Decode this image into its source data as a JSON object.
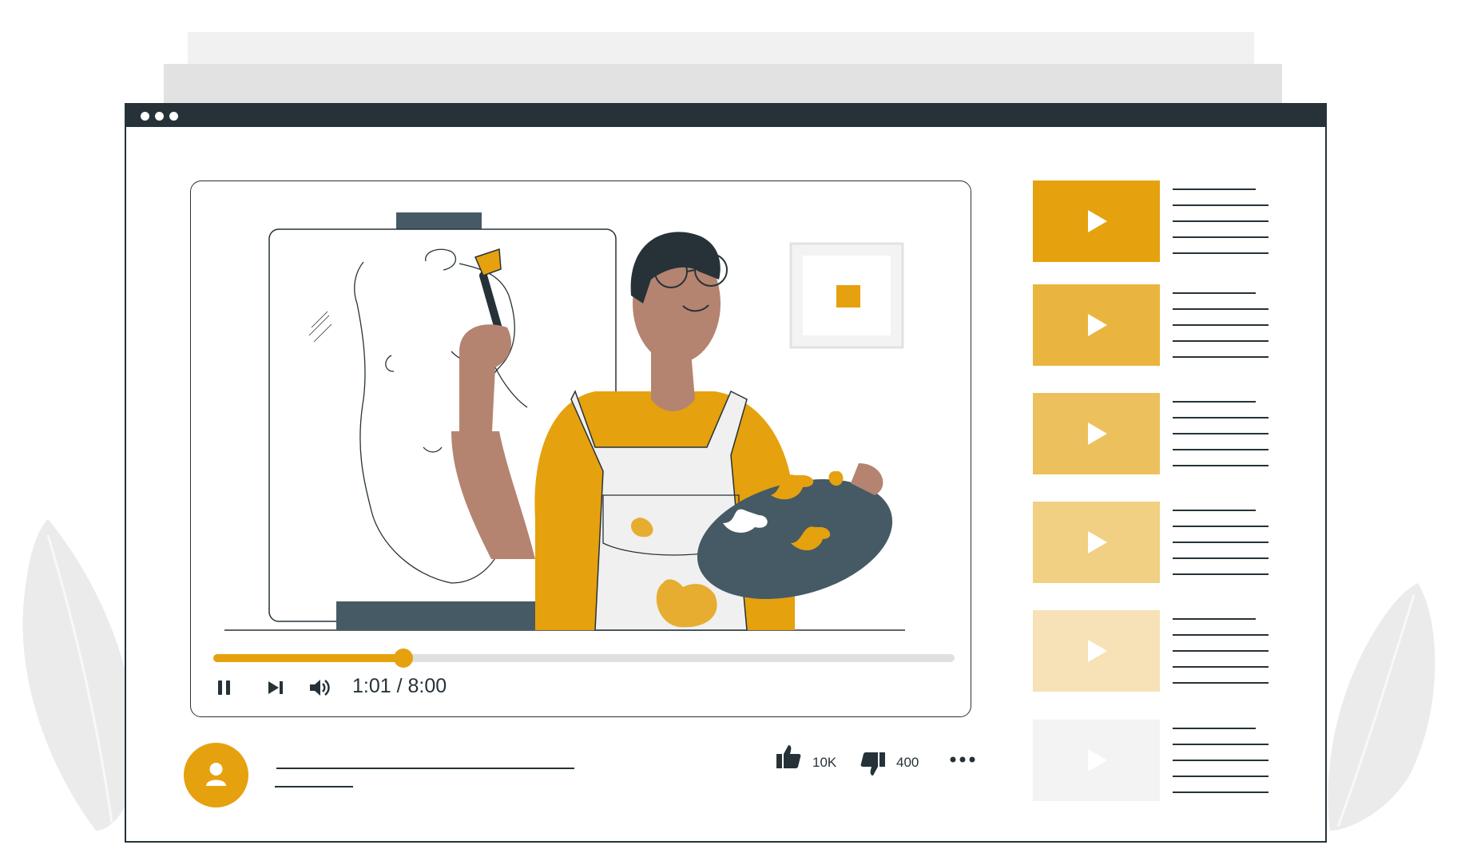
{
  "player": {
    "time": "1:01 / 8:00",
    "progress": 0.256
  },
  "icons": {
    "pause": "pause-icon",
    "next": "skip-next-icon",
    "volume": "volume-icon",
    "user": "user-icon",
    "like": "thumbs-up-icon",
    "dislike": "thumbs-down-icon",
    "more": "more-horizontal-icon",
    "play": "play-icon"
  },
  "reactions": {
    "likes": "10K",
    "dislikes": "400"
  },
  "playlist": {
    "thumb_colors": [
      "#e5a10e",
      "#eab53e",
      "#edc05e",
      "#f1d083",
      "#f6e2b6",
      "#f3f3f3"
    ]
  },
  "colors": {
    "accent": "#e5a10e",
    "dark": "#263238",
    "slate": "#455a64"
  }
}
